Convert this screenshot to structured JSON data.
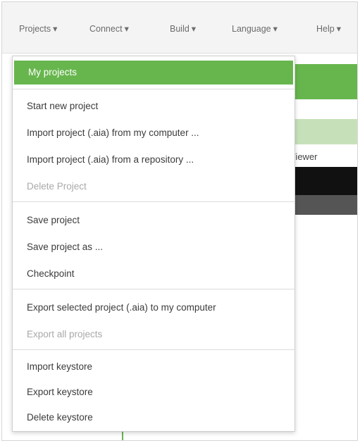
{
  "menubar": {
    "items": [
      {
        "label": "Projects"
      },
      {
        "label": "Connect"
      },
      {
        "label": "Build"
      },
      {
        "label": "Language"
      },
      {
        "label": "Help"
      }
    ],
    "caret": "▾"
  },
  "background": {
    "viewer_label": "Viewer"
  },
  "dropdown": {
    "items": [
      {
        "label": "My projects",
        "state": "selected"
      },
      {
        "label": "Start new project",
        "state": "enabled"
      },
      {
        "label": "Import project (.aia) from my computer ...",
        "state": "enabled"
      },
      {
        "label": "Import project (.aia) from a repository ...",
        "state": "enabled"
      },
      {
        "label": "Delete Project",
        "state": "disabled"
      },
      {
        "label": "Save project",
        "state": "enabled"
      },
      {
        "label": "Save project as ...",
        "state": "enabled"
      },
      {
        "label": "Checkpoint",
        "state": "enabled"
      },
      {
        "label": "Export selected project (.aia) to my computer",
        "state": "enabled"
      },
      {
        "label": "Export all projects",
        "state": "disabled"
      },
      {
        "label": "Import keystore",
        "state": "enabled"
      },
      {
        "label": "Export keystore",
        "state": "enabled"
      },
      {
        "label": "Delete keystore",
        "state": "enabled"
      }
    ]
  },
  "colors": {
    "accent": "#67b64d",
    "disabled_text": "#a9a9a9"
  }
}
